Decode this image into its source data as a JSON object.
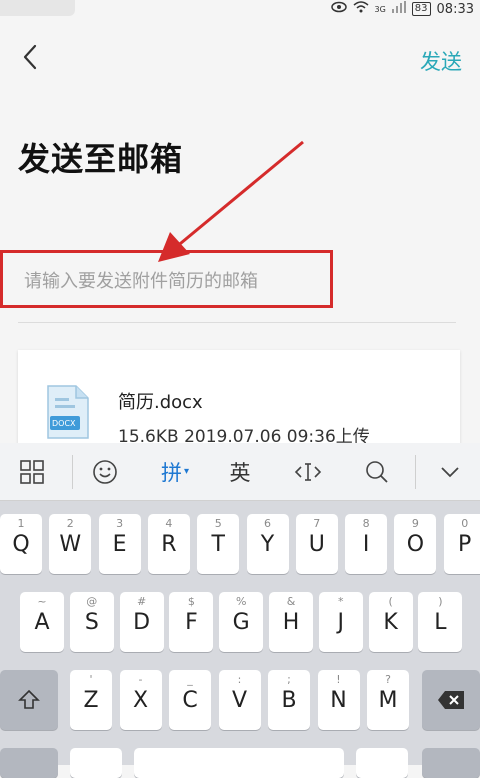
{
  "status": {
    "time": "08:33",
    "battery": "83",
    "network": "3G"
  },
  "appbar": {
    "send_label": "发送"
  },
  "page": {
    "title": "发送至邮箱"
  },
  "email_input": {
    "placeholder": "请输入要发送附件简历的邮箱",
    "value": ""
  },
  "attachment": {
    "icon_label": "DOCX",
    "name": "简历.docx",
    "meta": "15.6KB 2019.07.06 09:36上传"
  },
  "keyboard": {
    "toolbar": {
      "pinyin": "拼",
      "english": "英"
    },
    "row1": [
      {
        "sub": "1",
        "key": "Q"
      },
      {
        "sub": "2",
        "key": "W"
      },
      {
        "sub": "3",
        "key": "E"
      },
      {
        "sub": "4",
        "key": "R"
      },
      {
        "sub": "5",
        "key": "T"
      },
      {
        "sub": "6",
        "key": "Y"
      },
      {
        "sub": "7",
        "key": "U"
      },
      {
        "sub": "8",
        "key": "I"
      },
      {
        "sub": "9",
        "key": "O"
      },
      {
        "sub": "0",
        "key": "P"
      }
    ],
    "row2": [
      {
        "sub": "~",
        "key": "A"
      },
      {
        "sub": "@",
        "key": "S"
      },
      {
        "sub": "#",
        "key": "D"
      },
      {
        "sub": "$",
        "key": "F"
      },
      {
        "sub": "%",
        "key": "G"
      },
      {
        "sub": "&",
        "key": "H"
      },
      {
        "sub": "*",
        "key": "J"
      },
      {
        "sub": "(",
        "key": "K"
      },
      {
        "sub": ")",
        "key": "L"
      }
    ],
    "row3": [
      {
        "sub": "'",
        "key": "Z"
      },
      {
        "sub": "-",
        "key": "X"
      },
      {
        "sub": "_",
        "key": "C"
      },
      {
        "sub": ":",
        "key": "V"
      },
      {
        "sub": ";",
        "key": "B"
      },
      {
        "sub": "!",
        "key": "N"
      },
      {
        "sub": "?",
        "key": "M"
      }
    ]
  }
}
